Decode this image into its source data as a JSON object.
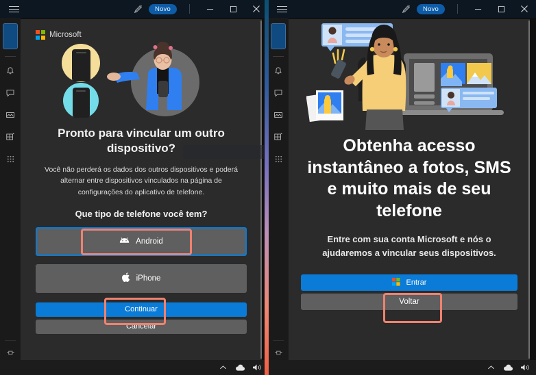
{
  "titlebar": {
    "menu_icon": "hamburger-icon",
    "pen_icon": "pen-icon",
    "badge_label": "Novo",
    "minimize_label": "─",
    "maximize_label": "□",
    "close_label": "×"
  },
  "rail": {
    "items": [
      {
        "icon": "account-tile",
        "name": "selected-tile"
      },
      {
        "icon": "bell-icon",
        "name": "notifications"
      },
      {
        "icon": "chat-icon",
        "name": "messages"
      },
      {
        "icon": "photos-icon",
        "name": "photos"
      },
      {
        "icon": "apps-icon",
        "name": "apps"
      },
      {
        "icon": "dialpad-icon",
        "name": "calls"
      }
    ],
    "pin_icon": "pin-icon"
  },
  "taskbar": {
    "tray": [
      "chevron-up-icon",
      "cloud-icon",
      "volume-icon"
    ]
  },
  "left_panel": {
    "brand": "Microsoft",
    "illustration": "two-phones-and-woman-illustration",
    "title": "Pronto para vincular um outro dispositivo?",
    "body": "Você não perderá os dados dos outros dispositivos e poderá alternar entre dispositivos vinculados na página de configurações do aplicativo de telefone.",
    "question": "Que tipo de telefone você tem?",
    "options": [
      {
        "label": "Android",
        "icon": "android-icon",
        "selected": true,
        "highlighted": true
      },
      {
        "label": "iPhone",
        "icon": "apple-icon",
        "selected": false,
        "highlighted": false
      }
    ],
    "primary_button": "Continuar",
    "secondary_button": "Cancelar",
    "primary_highlighted": true
  },
  "right_panel": {
    "illustration": "woman-with-phone-laptop-photos-illustration",
    "title": "Obtenha acesso instantâneo a fotos, SMS e muito mais de seu telefone",
    "body": "Entre com sua conta Microsoft e nós o ajudaremos a vincular seus dispositivos.",
    "primary_button": "Entrar",
    "primary_icon": "microsoft-logo-icon",
    "secondary_button": "Voltar",
    "primary_highlighted": true
  },
  "colors": {
    "accent_blue": "#0a7bd6",
    "highlight": "#f0826f",
    "card_bg": "#2b2b2b",
    "button_grey": "#5f5f5f",
    "badge_blue": "#0d5ca8"
  }
}
